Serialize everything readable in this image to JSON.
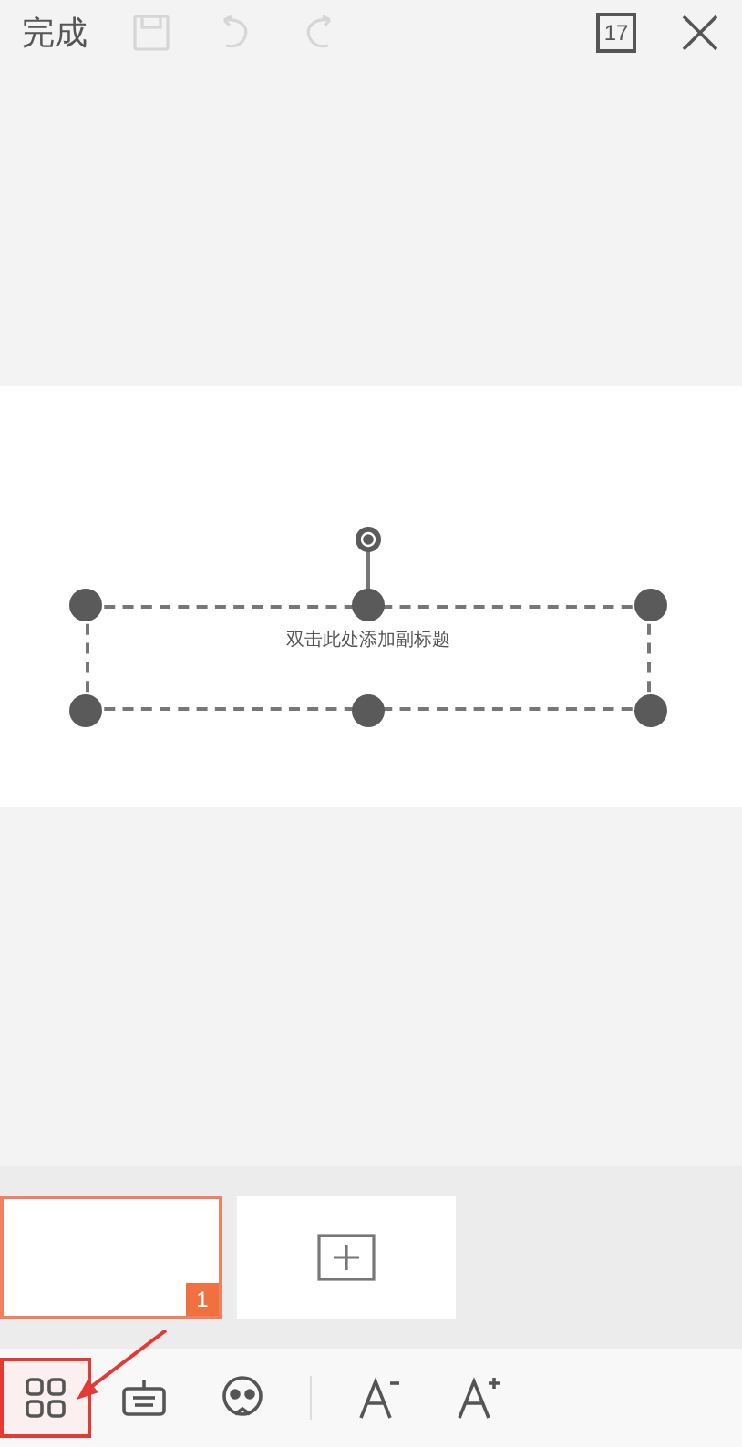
{
  "top_bar": {
    "done": "完成",
    "save_disabled": true,
    "undo_disabled": true,
    "redo_disabled": true,
    "slide_count": "17"
  },
  "slide": {
    "subtitle_placeholder": "双击此处添加副标题",
    "text_box_selected": true
  },
  "thumbnails": [
    {
      "number": "1",
      "selected": true
    }
  ],
  "toolbar": [
    {
      "kind": "grid",
      "highlighted": true
    },
    {
      "kind": "keyboard",
      "highlighted": false
    },
    {
      "kind": "face",
      "highlighted": false
    },
    {
      "kind": "divider"
    },
    {
      "kind": "font-decrease",
      "highlighted": false
    },
    {
      "kind": "font-increase",
      "highlighted": false
    }
  ]
}
